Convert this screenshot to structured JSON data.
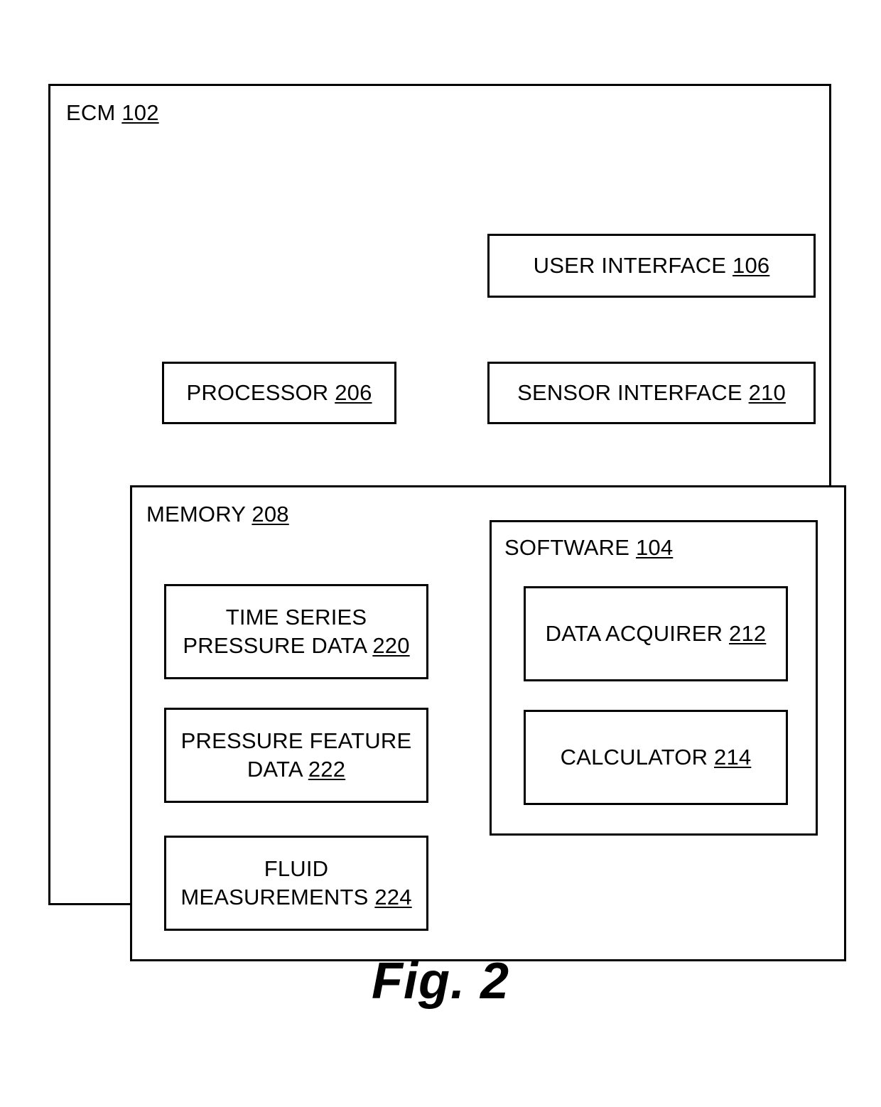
{
  "figure": {
    "caption": "Fig. 2"
  },
  "ecm": {
    "label": "ECM",
    "ref": "102",
    "blocks": {
      "user_interface": {
        "label": "USER INTERFACE",
        "ref": "106"
      },
      "processor": {
        "label": "PROCESSOR",
        "ref": "206"
      },
      "sensor_interface": {
        "label": "SENSOR INTERFACE",
        "ref": "210"
      }
    },
    "memory": {
      "label": "MEMORY",
      "ref": "208",
      "data_blocks": [
        {
          "line1": "TIME SERIES",
          "line2": "PRESSURE DATA",
          "ref": "220"
        },
        {
          "line1": "PRESSURE FEATURE",
          "line2": "DATA",
          "ref": "222"
        },
        {
          "line1": "FLUID",
          "line2": "MEASUREMENTS",
          "ref": "224"
        }
      ],
      "software": {
        "label": "SOFTWARE",
        "ref": "104",
        "modules": [
          {
            "label": "DATA ACQUIRER",
            "ref": "212"
          },
          {
            "label": "CALCULATOR",
            "ref": "214"
          }
        ]
      }
    }
  },
  "colors": {
    "line": "#000000",
    "background": "#ffffff"
  }
}
